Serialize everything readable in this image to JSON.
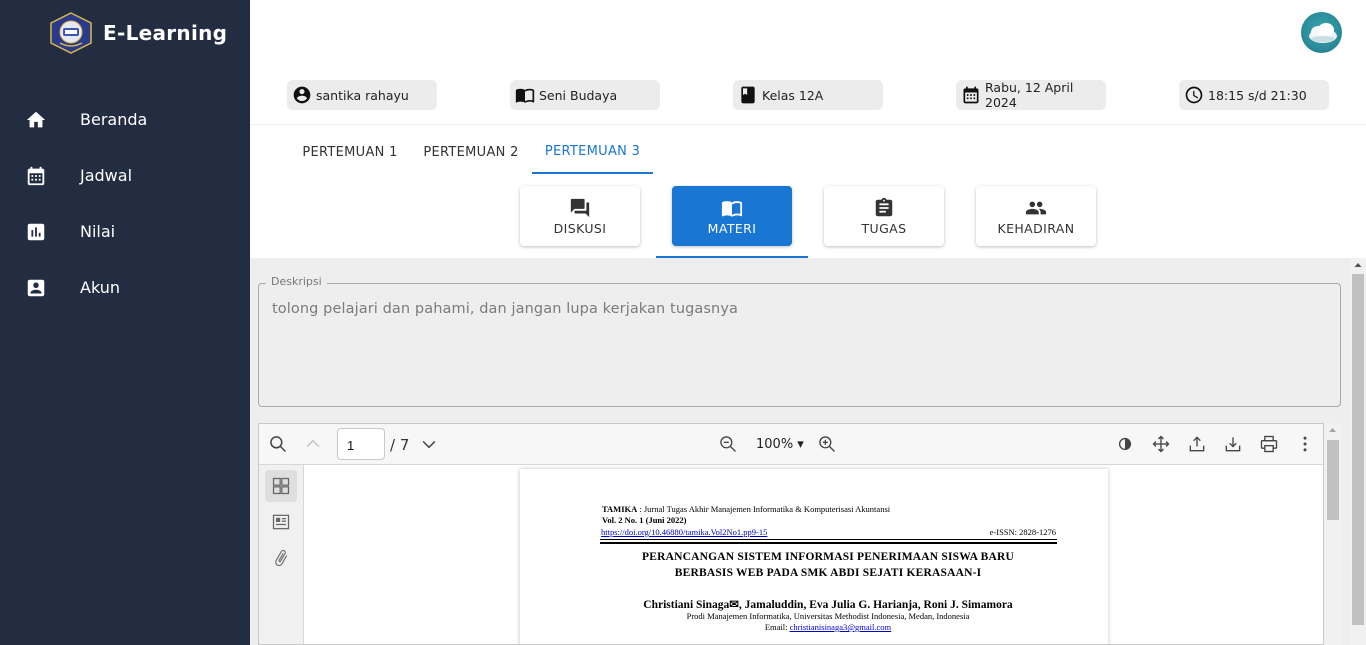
{
  "app": {
    "title": "E-Learning"
  },
  "sidebar": {
    "items": [
      {
        "label": "Beranda",
        "icon": "home-icon"
      },
      {
        "label": "Jadwal",
        "icon": "calendar-icon"
      },
      {
        "label": "Nilai",
        "icon": "chart-icon"
      },
      {
        "label": "Akun",
        "icon": "account-box-icon"
      }
    ]
  },
  "info": {
    "user": "santika rahayu",
    "subject": "Seni Budaya",
    "class": "Kelas 12A",
    "date": "Rabu, 12 April 2024",
    "time": "18:15 s/d 21:30"
  },
  "tabs": [
    {
      "label": "PERTEMUAN 1",
      "active": false
    },
    {
      "label": "PERTEMUAN 2",
      "active": false
    },
    {
      "label": "PERTEMUAN 3",
      "active": true
    }
  ],
  "sections": [
    {
      "label": "DISKUSI",
      "icon": "forum-icon",
      "active": false
    },
    {
      "label": "MATERI",
      "icon": "book-icon",
      "active": true
    },
    {
      "label": "TUGAS",
      "icon": "clipboard-icon",
      "active": false
    },
    {
      "label": "KEHADIRAN",
      "icon": "people-icon",
      "active": false
    }
  ],
  "description": {
    "label": "Deskripsi",
    "text": "tolong pelajari dan pahami, dan jangan lupa kerjakan tugasnya"
  },
  "pdf_viewer": {
    "current_page": "1",
    "total_pages": "/ 7",
    "zoom": "100%",
    "page": {
      "journal_name": "TAMIKA",
      "journal_desc": ": Jurnal Tugas Akhir Manajemen Informatika & Komputerisasi Akuntansi",
      "volume": "Vol. 2 No. 1 (Juni 2022)",
      "doi": "https://doi.org/10.46880/tamika.Vol2No1.pp9-15",
      "issn": "e-ISSN: 2828-1276",
      "title_line1": "PERANCANGAN SISTEM INFORMASI PENERIMAAN SISWA BARU",
      "title_line2": "BERBASIS WEB PADA SMK ABDI SEJATI KERASAAN-I",
      "authors": "Christiani Sinaga✉, Jamaluddin, Eva Julia G. Harianja, Roni J. Simamora",
      "affiliation": "Prodi Manajemen Informatika, Universitas Methodist Indonesia, Medan, Indonesia",
      "email_label": "Email:",
      "email": "christianisinaga3@gmail.com"
    }
  },
  "colors": {
    "sidebar_bg": "#222d42",
    "accent": "#1976d2",
    "content_bg": "#eeeeee"
  }
}
